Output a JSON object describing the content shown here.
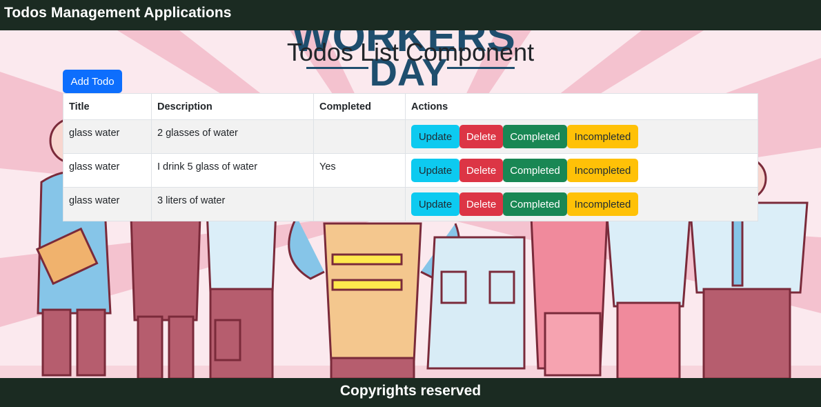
{
  "navbar": {
    "brand": "Todos Management Applications"
  },
  "background": {
    "poster_text_top": "WORKERS",
    "poster_text_bottom": "DAY"
  },
  "main": {
    "title": "Todos List Component",
    "add_button": "Add Todo",
    "columns": [
      "Title",
      "Description",
      "Completed",
      "Actions"
    ],
    "rows": [
      {
        "title": "glass water",
        "description": "2 glasses of water",
        "completed": ""
      },
      {
        "title": "glass water",
        "description": "I drink 5 glass of water",
        "completed": "Yes"
      },
      {
        "title": "glass water",
        "description": "3 liters of water",
        "completed": ""
      }
    ],
    "actions": {
      "update": "Update",
      "delete": "Delete",
      "completed": "Completed",
      "incompleted": "Incompleted"
    }
  },
  "footer": {
    "text": "Copyrights reserved"
  },
  "colors": {
    "navbar": "#1b2b22",
    "primary": "#0d6efd",
    "info": "#0dcaf0",
    "danger": "#dc3545",
    "success": "#198754",
    "warning": "#ffc107"
  }
}
